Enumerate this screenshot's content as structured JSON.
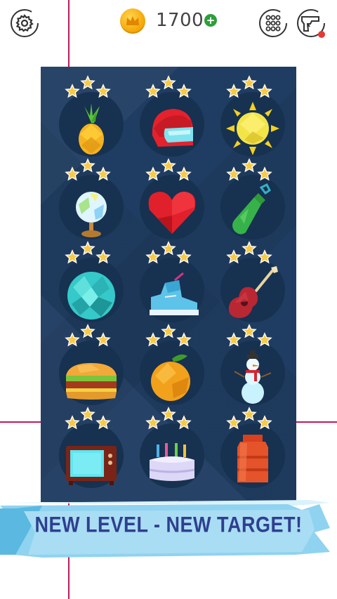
{
  "top_bar": {
    "coins": "1700",
    "plus": "+"
  },
  "levels": [
    {
      "item": "pineapple",
      "stars": 3
    },
    {
      "item": "helmet",
      "stars": 3
    },
    {
      "item": "sun",
      "stars": 3
    },
    {
      "item": "globe",
      "stars": 3
    },
    {
      "item": "heart",
      "stars": 3
    },
    {
      "item": "bottle",
      "stars": 3
    },
    {
      "item": "disco-ball",
      "stars": 3
    },
    {
      "item": "sneaker",
      "stars": 3
    },
    {
      "item": "guitar",
      "stars": 3
    },
    {
      "item": "burger",
      "stars": 3
    },
    {
      "item": "orange",
      "stars": 3
    },
    {
      "item": "snowman",
      "stars": 3
    },
    {
      "item": "tv",
      "stars": 3
    },
    {
      "item": "cake",
      "stars": 3
    },
    {
      "item": "canister",
      "stars": 3
    }
  ],
  "banner": {
    "text": "NEW LEVEL - NEW TARGET!"
  },
  "colors": {
    "board": "#1f3d62",
    "star": "#f7c948",
    "banner": "#8fd3f0",
    "banner_text": "#2f3f8f",
    "guide_lines": "#c2185b"
  },
  "icons": {
    "settings": "gear-icon",
    "coin": "crown-coin-icon",
    "levels": "grid-dots-icon",
    "weapons": "gun-icon"
  }
}
